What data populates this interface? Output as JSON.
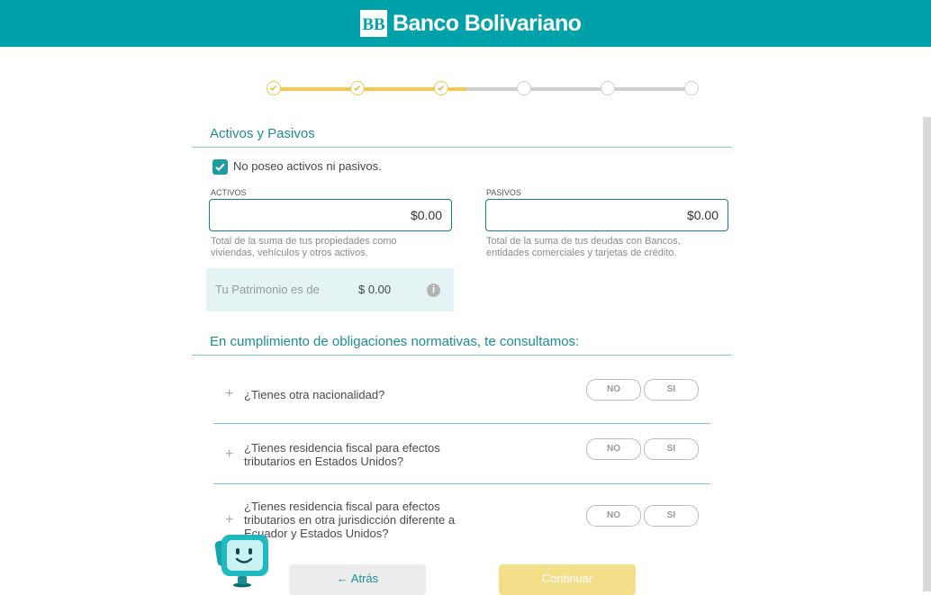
{
  "header": {
    "brand_name": "Banco Bolivariano",
    "logo_icon": "bb-logo-icon"
  },
  "colors": {
    "teal": "#00a1a9",
    "step_done": "#f2c94c",
    "step_pending": "#cfcfcf"
  },
  "stepper": {
    "total_steps": 6,
    "completed_steps": 3,
    "progress_fraction": 0.47
  },
  "section_assets": {
    "title": "Activos y Pasivos",
    "checkbox_label": "No poseo activos ni pasivos.",
    "checkbox_checked": true,
    "activos": {
      "label": "ACTIVOS",
      "value": "$0.00",
      "help": "Total de la suma de tus propiedades como viviendas, vehículos y otros activos."
    },
    "pasivos": {
      "label": "PASIVOS",
      "value": "$0.00",
      "help": "Total de la suma de tus deudas con Bancos, entidades comerciales y tarjetas de crédito."
    },
    "patrimonio": {
      "label": "Tu Patrimonio es de",
      "value": "$ 0.00",
      "info_icon": "info-icon"
    }
  },
  "section_compliance": {
    "title": "En cumplimiento de obligaciones normativas, te consultamos:",
    "questions": [
      {
        "text": "¿Tienes otra nacionalidad?",
        "no": "NO",
        "yes": "SI"
      },
      {
        "text": "¿Tienes residencia fiscal para efectos tributarios en Estados Unidos?",
        "no": "NO",
        "yes": "SI"
      },
      {
        "text": "¿Tienes residencia fiscal para efectos tributarios en otra jurisdicción diferente a Ecuador y Estados Unidos?",
        "no": "NO",
        "yes": "SI"
      }
    ]
  },
  "footer": {
    "back_label": "Atrás",
    "back_icon": "arrow-left-icon",
    "continue_label": "Continuar"
  },
  "assistant": {
    "icon": "chat-assistant-icon"
  }
}
